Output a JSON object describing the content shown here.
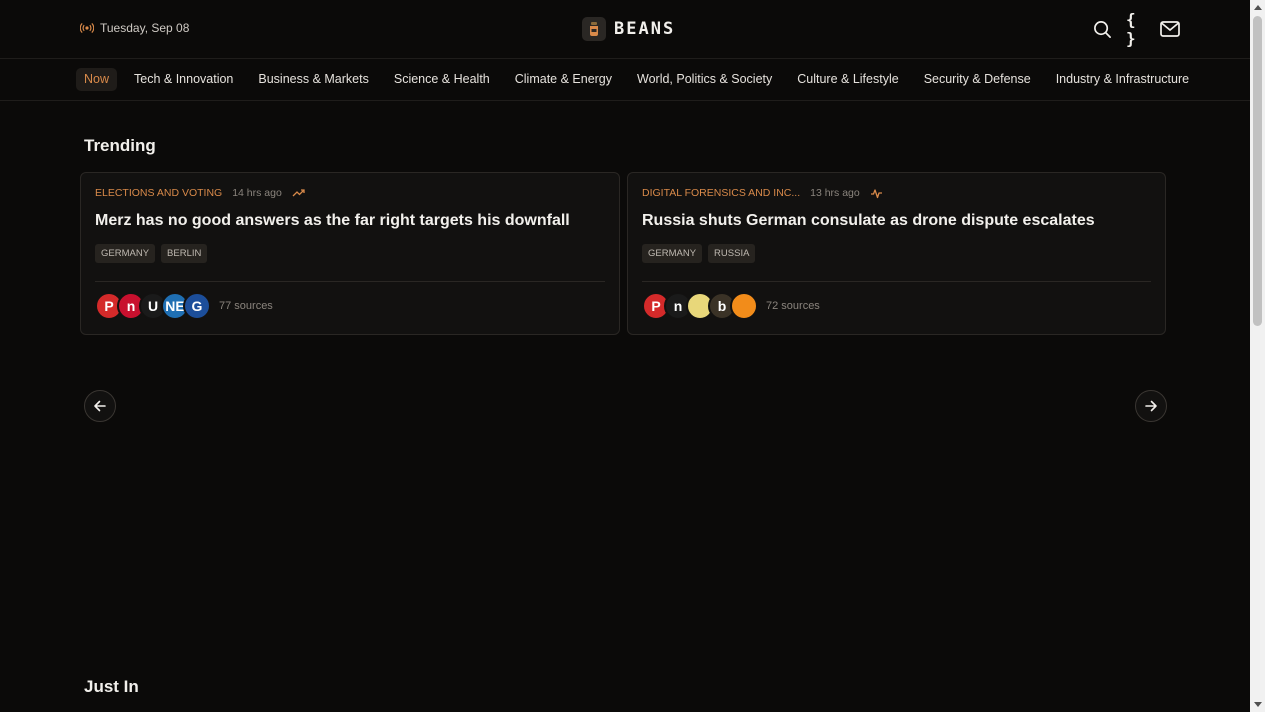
{
  "header": {
    "date": "Tuesday, Sep 08",
    "brand": "BEANS",
    "actions": [
      "search-icon",
      "braces-icon",
      "mail-icon"
    ],
    "braces_glyph": "{ }"
  },
  "nav": {
    "items": [
      {
        "label": "Now",
        "active": true
      },
      {
        "label": "Tech & Innovation"
      },
      {
        "label": "Business & Markets"
      },
      {
        "label": "Science & Health"
      },
      {
        "label": "Climate & Energy"
      },
      {
        "label": "World, Politics & Society"
      },
      {
        "label": "Culture & Lifestyle"
      },
      {
        "label": "Security & Defense"
      },
      {
        "label": "Industry & Infrastructure"
      }
    ]
  },
  "trending": {
    "title": "Trending",
    "cards": [
      {
        "category": "ELECTIONS AND VOTING",
        "time": "14 hrs ago",
        "trend_icon": "trending-up-icon",
        "headline": "Merz has no good answers as the far right targets his downfall",
        "tags": [
          "GERMANY",
          "BERLIN"
        ],
        "source_icons": [
          {
            "glyph": "P",
            "bg": "#d42a2a"
          },
          {
            "glyph": "n",
            "bg": "#c8102e"
          },
          {
            "glyph": "U",
            "bg": "#1a1a1a"
          },
          {
            "glyph": "NE",
            "bg": "#1f6fb3"
          },
          {
            "glyph": "G",
            "bg": "#1c4e9a"
          }
        ],
        "sources": "77 sources"
      },
      {
        "category": "DIGITAL FORENSICS AND INC...",
        "time": "13 hrs ago",
        "trend_icon": "activity-icon",
        "headline": "Russia shuts German consulate as drone dispute escalates",
        "tags": [
          "GERMANY",
          "RUSSIA"
        ],
        "source_icons": [
          {
            "glyph": "P",
            "bg": "#d42a2a"
          },
          {
            "glyph": "n",
            "bg": "#1a1a1a"
          },
          {
            "glyph": "",
            "bg": "#e8d77a"
          },
          {
            "glyph": "b",
            "bg": "#3a3226"
          },
          {
            "glyph": "",
            "bg": "#f28c1a"
          }
        ],
        "sources": "72 sources"
      }
    ]
  },
  "just_in": {
    "title": "Just In"
  },
  "colors": {
    "accent": "#d98a4a",
    "background": "#0b0a09"
  }
}
